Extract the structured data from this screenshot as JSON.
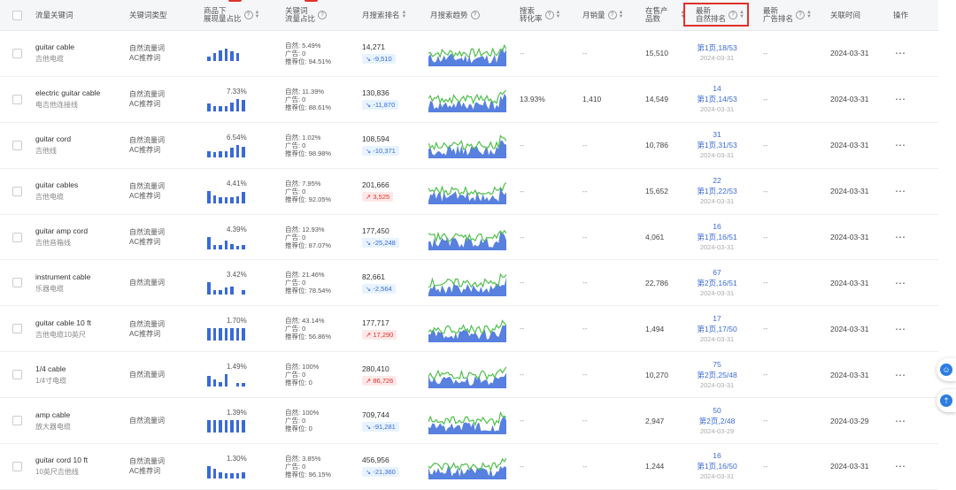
{
  "headers": {
    "keyword": "流量关键词",
    "type": "关键词类型",
    "share": "商品下\n展现量占比",
    "flow": "关键词\n流量占比",
    "rank": "月搜索排名",
    "trend": "月搜索趋势",
    "conv": "搜索\n转化率",
    "sales": "月销量",
    "products": "在售产\n品数",
    "natural": "最新\n自然排名",
    "ad": "最新\n广告排名",
    "assoc": "关联时间",
    "ops": "操作",
    "beta": "beta"
  },
  "icons": {
    "help": "question-circle-icon",
    "sort": "sort-arrows-icon",
    "trend_down": "trend-down-icon",
    "trend_up": "trend-up-icon",
    "more": "more-dots-icon",
    "service": "customer-service-icon",
    "back_top": "back-to-top-icon"
  },
  "colors": {
    "accent": "#3a6ad9",
    "highlight": "#e0322b",
    "trend_green": "#4fc04a",
    "trend_blue": "#3a6ad9"
  },
  "rows": [
    {
      "kw_en": "guitar cable",
      "kw_cn": "吉他电缆",
      "types": [
        "自然流量词",
        "AC推荐词"
      ],
      "share": "",
      "share_bars": [
        0.4,
        0.7,
        0.9,
        1,
        0.85,
        0.7
      ],
      "flow": [
        "自然: 5.49%",
        "广告: 0",
        "推荐位: 94.51%"
      ],
      "rank": "14,271",
      "chg": "-9,510",
      "dir": "down",
      "conv": "--",
      "sales": "--",
      "products": "15,510",
      "nat_num": "",
      "nat_pos": "第1页,18/53",
      "nat_date": "2024-03-31",
      "ad": "--",
      "assoc": "2024-03-31"
    },
    {
      "kw_en": "electric guitar cable",
      "kw_cn": "电吉他连接线",
      "types": [
        "自然流量词",
        "AC推荐词"
      ],
      "share": "7.33%",
      "share_bars": [
        0.6,
        0.45,
        0.4,
        0.45,
        0.7,
        1,
        0.9
      ],
      "flow": [
        "自然: 11.39%",
        "广告: 0",
        "推荐位: 88.61%"
      ],
      "rank": "130,836",
      "chg": "-11,870",
      "dir": "down",
      "conv": "13.93%",
      "sales": "1,410",
      "products": "14,549",
      "nat_num": "14",
      "nat_pos": "第1页,14/53",
      "nat_date": "2024-03-31",
      "ad": "--",
      "assoc": "2024-03-31"
    },
    {
      "kw_en": "guitar cord",
      "kw_cn": "吉他线",
      "types": [
        "自然流量词",
        "AC推荐词"
      ],
      "share": "6.54%",
      "share_bars": [
        0.5,
        0.4,
        0.45,
        0.5,
        0.8,
        1,
        0.85
      ],
      "flow": [
        "自然: 1.02%",
        "广告: 0",
        "推荐位: 98.98%"
      ],
      "rank": "108,594",
      "chg": "-10,371",
      "dir": "down",
      "conv": "--",
      "sales": "--",
      "products": "10,786",
      "nat_num": "31",
      "nat_pos": "第1页,31/53",
      "nat_date": "2024-03-31",
      "ad": "--",
      "assoc": "2024-03-31"
    },
    {
      "kw_en": "guitar cables",
      "kw_cn": "吉他电缆",
      "types": [
        "自然流量词",
        "AC推荐词"
      ],
      "share": "4.41%",
      "share_bars": [
        1,
        0.6,
        0.45,
        0.45,
        0.5,
        0.55,
        0.9
      ],
      "flow": [
        "自然: 7.95%",
        "广告: 0",
        "推荐位: 92.05%"
      ],
      "rank": "201,666",
      "chg": "3,525",
      "dir": "up",
      "conv": "--",
      "sales": "--",
      "products": "15,652",
      "nat_num": "22",
      "nat_pos": "第1页,22/53",
      "nat_date": "2024-03-31",
      "ad": "--",
      "assoc": "2024-03-31"
    },
    {
      "kw_en": "guitar amp cord",
      "kw_cn": "吉他音箱线",
      "types": [
        "自然流量词",
        "AC推荐词"
      ],
      "share": "4.39%",
      "share_bars": [
        1,
        0.3,
        0.35,
        0.7,
        0.4,
        0.25,
        0.3
      ],
      "flow": [
        "自然: 12.93%",
        "广告: 0",
        "推荐位: 87.07%"
      ],
      "rank": "177,450",
      "chg": "-25,248",
      "dir": "down",
      "conv": "--",
      "sales": "--",
      "products": "4,061",
      "nat_num": "16",
      "nat_pos": "第1页,16/51",
      "nat_date": "2024-03-31",
      "ad": "--",
      "assoc": "2024-03-31"
    },
    {
      "kw_en": "instrument cable",
      "kw_cn": "乐器电缆",
      "types": [
        "自然流量词"
      ],
      "share": "3.42%",
      "share_bars": [
        1,
        0.4,
        0.4,
        0.6,
        0.7,
        0,
        0.4
      ],
      "flow": [
        "自然: 21.46%",
        "广告: 0",
        "推荐位: 78.54%"
      ],
      "rank": "82,661",
      "chg": "-2,564",
      "dir": "down",
      "conv": "--",
      "sales": "--",
      "products": "22,786",
      "nat_num": "67",
      "nat_pos": "第2页,16/51",
      "nat_date": "2024-03-31",
      "ad": "--",
      "assoc": "2024-03-31"
    },
    {
      "kw_en": "guitar cable 10 ft",
      "kw_cn": "吉他电缆10英尺",
      "types": [
        "自然流量词",
        "AC推荐词"
      ],
      "share": "1.70%",
      "share_bars": [
        1,
        1,
        1,
        1,
        1,
        1,
        1
      ],
      "flow": [
        "自然: 43.14%",
        "广告: 0",
        "推荐位: 56.86%"
      ],
      "rank": "177,717",
      "chg": "17,290",
      "dir": "up",
      "conv": "--",
      "sales": "--",
      "products": "1,494",
      "nat_num": "17",
      "nat_pos": "第1页,17/50",
      "nat_date": "2024-03-31",
      "ad": "--",
      "assoc": "2024-03-31"
    },
    {
      "kw_en": "1/4 cable",
      "kw_cn": "1/4寸电缆",
      "types": [
        "自然流量词"
      ],
      "share": "1.49%",
      "share_bars": [
        0.9,
        0.6,
        0.4,
        1,
        0,
        0.3,
        0.3
      ],
      "flow": [
        "自然: 100%",
        "广告: 0",
        "推荐位: 0"
      ],
      "rank": "280,410",
      "chg": "86,726",
      "dir": "up",
      "conv": "--",
      "sales": "--",
      "products": "10,270",
      "nat_num": "75",
      "nat_pos": "第2页,25/48",
      "nat_date": "2024-03-31",
      "ad": "--",
      "assoc": "2024-03-31"
    },
    {
      "kw_en": "amp cable",
      "kw_cn": "放大器电缆",
      "types": [
        "自然流量词"
      ],
      "share": "1.39%",
      "share_bars": [
        1,
        1,
        1,
        1,
        1,
        1,
        1
      ],
      "flow": [
        "自然: 100%",
        "广告: 0",
        "推荐位: 0"
      ],
      "rank": "709,744",
      "chg": "-91,281",
      "dir": "down",
      "conv": "--",
      "sales": "--",
      "products": "2,947",
      "nat_num": "50",
      "nat_pos": "第2页,2/48",
      "nat_date": "2024-03-29",
      "ad": "--",
      "assoc": "2024-03-29"
    },
    {
      "kw_en": "guitar cord 10 ft",
      "kw_cn": "10英尺吉他线",
      "types": [
        "自然流量词",
        "AC推荐词"
      ],
      "share": "1.30%",
      "share_bars": [
        1,
        0.8,
        0.5,
        0.45,
        0.45,
        0.45,
        0.5
      ],
      "flow": [
        "自然: 3.85%",
        "广告: 0",
        "推荐位: 96.15%"
      ],
      "rank": "456,956",
      "chg": "-21,360",
      "dir": "down",
      "conv": "--",
      "sales": "--",
      "products": "1,244",
      "nat_num": "16",
      "nat_pos": "第1页,16/50",
      "nat_date": "2024-03-31",
      "ad": "--",
      "assoc": "2024-03-31"
    }
  ]
}
